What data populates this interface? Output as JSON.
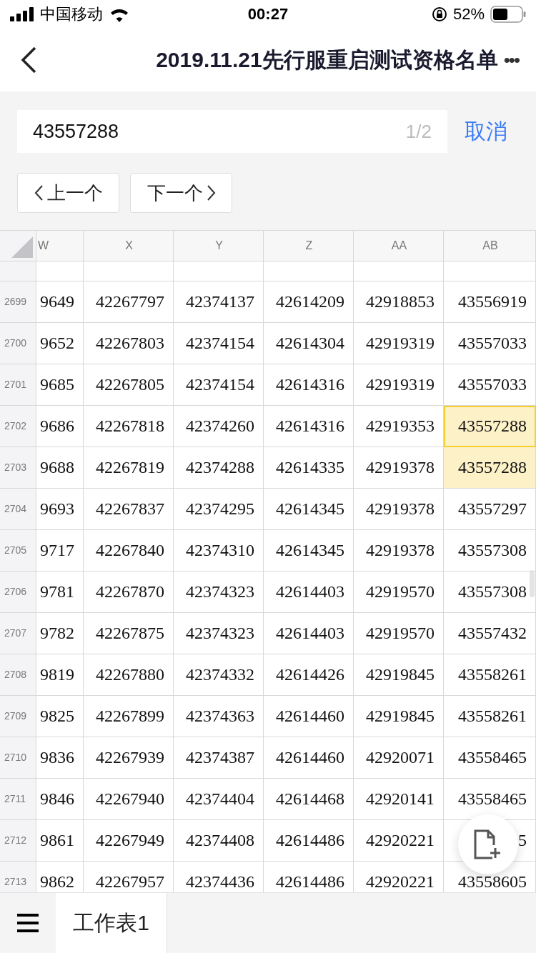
{
  "status_bar": {
    "carrier": "中国移动",
    "time": "00:27",
    "battery_percent": "52%"
  },
  "header": {
    "title": "2019.11.21先行服重启测试资格名单",
    "more": "•••"
  },
  "search": {
    "value": "43557288",
    "count": "1/2",
    "cancel": "取消"
  },
  "nav_buttons": [
    {
      "label": "上一个",
      "kind": "prev"
    },
    {
      "label": "下一个",
      "kind": "next"
    }
  ],
  "table": {
    "columns": [
      "W",
      "X",
      "Y",
      "Z",
      "AA",
      "AB"
    ],
    "rows": [
      {
        "number": "2699",
        "cells": [
          "9649",
          "42267797",
          "42374137",
          "42614209",
          "42918853",
          "43556919"
        ],
        "selected": false,
        "highlighted": false
      },
      {
        "number": "2700",
        "cells": [
          "9652",
          "42267803",
          "42374154",
          "42614304",
          "42919319",
          "43557033"
        ],
        "selected": false,
        "highlighted": false
      },
      {
        "number": "2701",
        "cells": [
          "9685",
          "42267805",
          "42374154",
          "42614316",
          "42919319",
          "43557033"
        ],
        "selected": false,
        "highlighted": false
      },
      {
        "number": "2702",
        "cells": [
          "9686",
          "42267818",
          "42374260",
          "42614316",
          "42919353",
          "43557288"
        ],
        "selected": true,
        "highlighted": true
      },
      {
        "number": "2703",
        "cells": [
          "9688",
          "42267819",
          "42374288",
          "42614335",
          "42919378",
          "43557288"
        ],
        "selected": false,
        "highlighted": true
      },
      {
        "number": "2704",
        "cells": [
          "9693",
          "42267837",
          "42374295",
          "42614345",
          "42919378",
          "43557297"
        ],
        "selected": false,
        "highlighted": false
      },
      {
        "number": "2705",
        "cells": [
          "9717",
          "42267840",
          "42374310",
          "42614345",
          "42919378",
          "43557308"
        ],
        "selected": false,
        "highlighted": false
      },
      {
        "number": "2706",
        "cells": [
          "9781",
          "42267870",
          "42374323",
          "42614403",
          "42919570",
          "43557308"
        ],
        "selected": false,
        "highlighted": false
      },
      {
        "number": "2707",
        "cells": [
          "9782",
          "42267875",
          "42374323",
          "42614403",
          "42919570",
          "43557432"
        ],
        "selected": false,
        "highlighted": false
      },
      {
        "number": "2708",
        "cells": [
          "9819",
          "42267880",
          "42374332",
          "42614426",
          "42919845",
          "43558261"
        ],
        "selected": false,
        "highlighted": false
      },
      {
        "number": "2709",
        "cells": [
          "9825",
          "42267899",
          "42374363",
          "42614460",
          "42919845",
          "43558261"
        ],
        "selected": false,
        "highlighted": false
      },
      {
        "number": "2710",
        "cells": [
          "9836",
          "42267939",
          "42374387",
          "42614460",
          "42920071",
          "43558465"
        ],
        "selected": false,
        "highlighted": false
      },
      {
        "number": "2711",
        "cells": [
          "9846",
          "42267940",
          "42374404",
          "42614468",
          "42920141",
          "43558465"
        ],
        "selected": false,
        "highlighted": false
      },
      {
        "number": "2712",
        "cells": [
          "9861",
          "42267949",
          "42374408",
          "42614486",
          "42920221",
          "5"
        ],
        "selected": false,
        "highlighted": false
      },
      {
        "number": "2713",
        "cells": [
          "9862",
          "42267957",
          "42374436",
          "42614486",
          "42920221",
          "43558605"
        ],
        "selected": false,
        "highlighted": false
      }
    ]
  },
  "sheet_tabs": [
    {
      "label": "工作表1",
      "selected": true
    }
  ]
}
